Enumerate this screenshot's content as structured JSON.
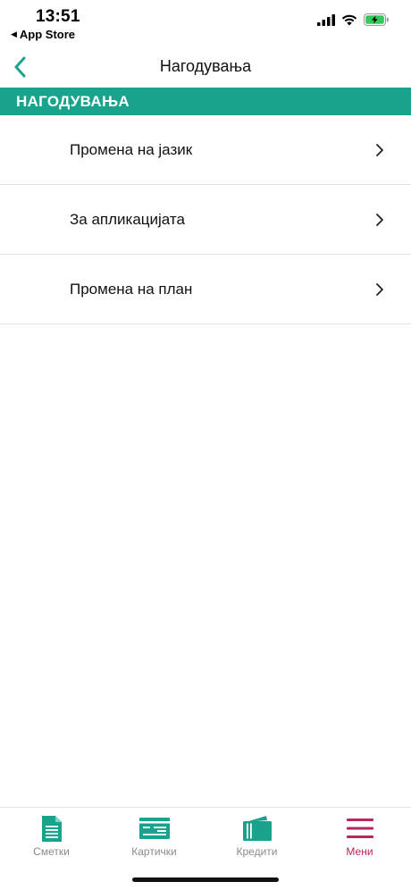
{
  "status_bar": {
    "time": "13:51",
    "back_app": "App Store",
    "icons": [
      "cellular-signal-icon",
      "wifi-icon",
      "battery-charging-icon"
    ]
  },
  "nav": {
    "title": "Нагодувања"
  },
  "section": {
    "title": "НАГОДУВАЊА"
  },
  "menu": {
    "items": [
      {
        "label": "Промена на јазик"
      },
      {
        "label": "За апликацијата"
      },
      {
        "label": "Промена на план"
      }
    ]
  },
  "tabs": [
    {
      "label": "Сметки",
      "icon": "document-icon",
      "active": false
    },
    {
      "label": "Картички",
      "icon": "card-icon",
      "active": false
    },
    {
      "label": "Кредити",
      "icon": "wallet-icon",
      "active": false
    },
    {
      "label": "Мени",
      "icon": "hamburger-icon",
      "active": true
    }
  ],
  "colors": {
    "accent": "#1aa38c",
    "active_tab": "#b8255f",
    "inactive_tab": "#8a8a8a",
    "battery": "#34c759"
  }
}
